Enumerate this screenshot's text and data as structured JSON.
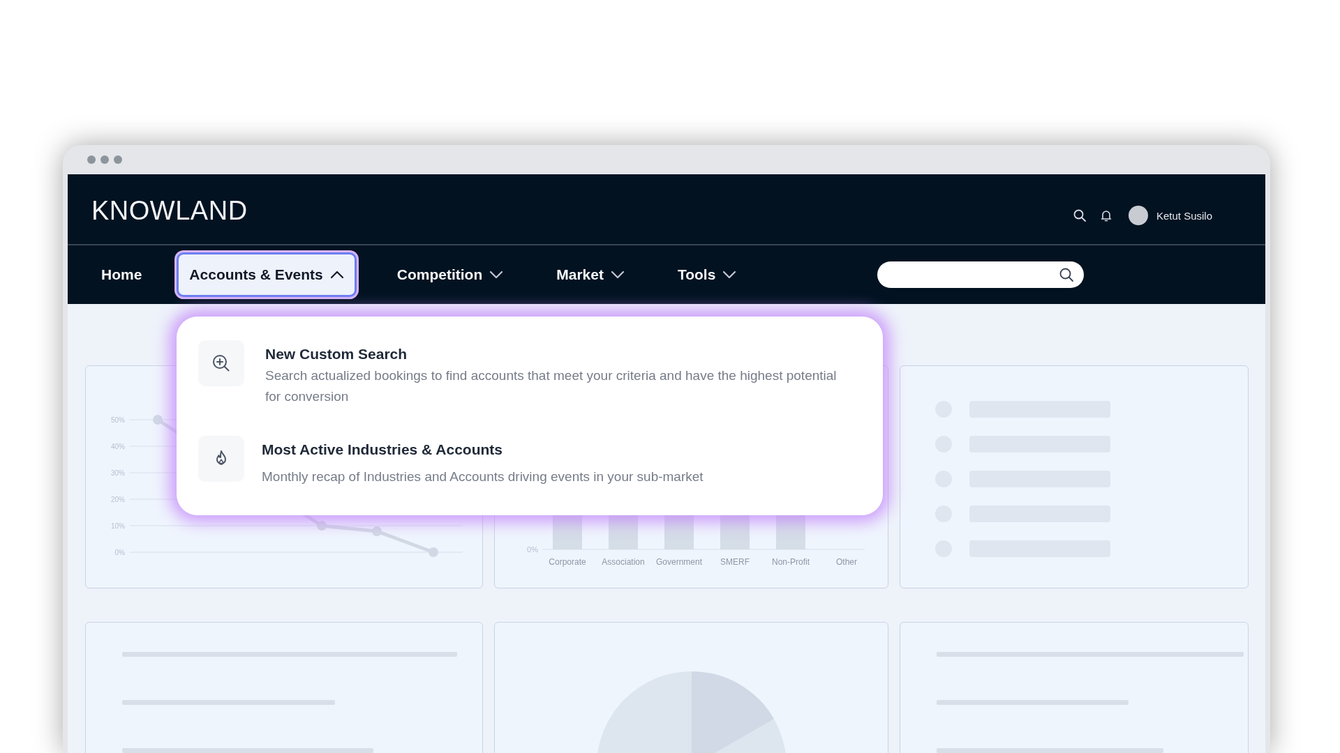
{
  "header": {
    "logo": "KNOWLAND",
    "user_name": "Ketut Susilo"
  },
  "nav": {
    "items": [
      {
        "label": "Home",
        "kind": "link",
        "selected": false
      },
      {
        "label": "Accounts & Events",
        "kind": "menu",
        "selected": true,
        "expanded": true
      },
      {
        "label": "Competition",
        "kind": "menu",
        "selected": false,
        "expanded": false
      },
      {
        "label": "Market",
        "kind": "menu",
        "selected": false,
        "expanded": false
      },
      {
        "label": "Tools",
        "kind": "menu",
        "selected": false,
        "expanded": false
      }
    ]
  },
  "dropdown": {
    "items": [
      {
        "kind": "search",
        "title": "New Custom Search",
        "description": "Search actualized bookings to find accounts that meet your criteria and have the highest potential for conversion"
      },
      {
        "kind": "trending",
        "title": "Most Active Industries & Accounts",
        "description": "Monthly recap of Industries and Accounts driving events in your sub-market"
      }
    ]
  },
  "line_chart": {
    "y_ticks": [
      "50%",
      "40%",
      "30%",
      "20%",
      "10%",
      "0%"
    ]
  },
  "bar_chart": {
    "y_tick": "0%",
    "categories": [
      "Corporate",
      "Association",
      "Government",
      "SMERF",
      "Non-Profit",
      "Other"
    ]
  }
}
